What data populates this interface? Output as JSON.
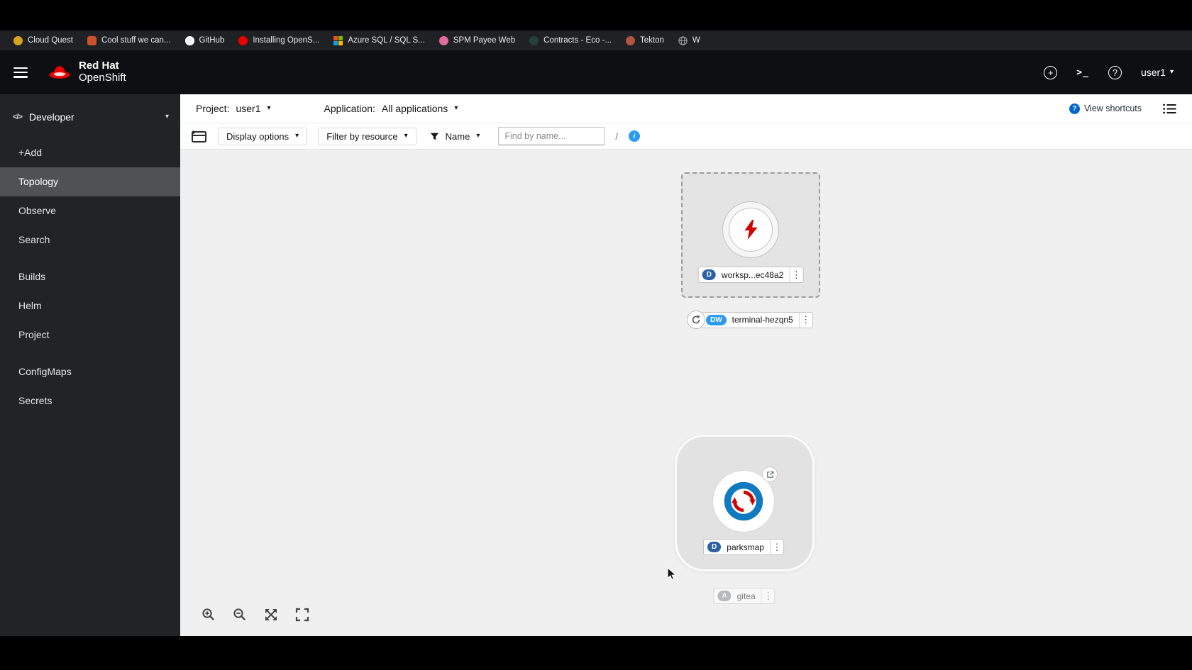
{
  "bookmarks": {
    "items": [
      {
        "label": "Cloud Quest",
        "color": "#d9a41b"
      },
      {
        "label": "Cool stuff we can...",
        "color": "#c9512e"
      },
      {
        "label": "GitHub",
        "color": "#f0f0f0"
      },
      {
        "label": "Installing OpenS...",
        "color": "#ee0000"
      },
      {
        "label": "Azure SQL / SQL S...",
        "color": "#0078d4"
      },
      {
        "label": "SPM Payee Web",
        "color": "#e06c9f"
      },
      {
        "label": "Contracts - Eco -...",
        "color": "#24413c"
      },
      {
        "label": "Tekton",
        "color": "#b3543f"
      },
      {
        "label": "W",
        "color": "#9aa0a6"
      }
    ]
  },
  "masthead": {
    "brand_top": "Red Hat",
    "brand_bottom": "OpenShift",
    "user": "user1"
  },
  "icons": {
    "caret_down": "▾",
    "kebab": "⋮",
    "terminal_glyph": ">_",
    "question": "?",
    "plus": "+",
    "info": "i",
    "code": "</>"
  },
  "sidebar": {
    "perspective": "Developer",
    "active_item": "Topology",
    "items": [
      {
        "label": "+Add"
      },
      {
        "label": "Topology"
      },
      {
        "label": "Observe"
      },
      {
        "label": "Search"
      },
      {
        "label": "Builds"
      },
      {
        "label": "Helm"
      },
      {
        "label": "Project"
      },
      {
        "label": "ConfigMaps"
      },
      {
        "label": "Secrets"
      }
    ]
  },
  "context_bar": {
    "project_label": "Project:",
    "project_value": "user1",
    "application_label": "Application:",
    "application_value": "All applications",
    "view_shortcuts": "View shortcuts"
  },
  "toolbar": {
    "display_options": "Display options",
    "filter_by_resource": "Filter by resource",
    "name_filter": "Name",
    "search_placeholder": "Find by name...",
    "slash_hint": "/"
  },
  "topology": {
    "workspace_node": {
      "badge": "D",
      "badge_color": "#2b61a4",
      "name": "worksp...ec48a2"
    },
    "terminal_node": {
      "badge": "DW",
      "badge_color": "#2b9af3",
      "name": "terminal-hezqn5"
    },
    "parksmap_node": {
      "badge": "D",
      "badge_color": "#2b61a4",
      "name": "parksmap"
    },
    "gitea_node": {
      "badge": "A",
      "badge_color": "#8a8d90",
      "name": "gitea"
    }
  },
  "colors": {
    "masthead_bg": "#0e0f12",
    "sidebar_bg": "#212427",
    "sidebar_active_bg": "#4f5255",
    "canvas_bg": "#f0f0f0",
    "brand_red": "#ee0000",
    "accent_blue": "#0066cc",
    "info_blue": "#2b9af3",
    "node_red": "#d20000"
  }
}
